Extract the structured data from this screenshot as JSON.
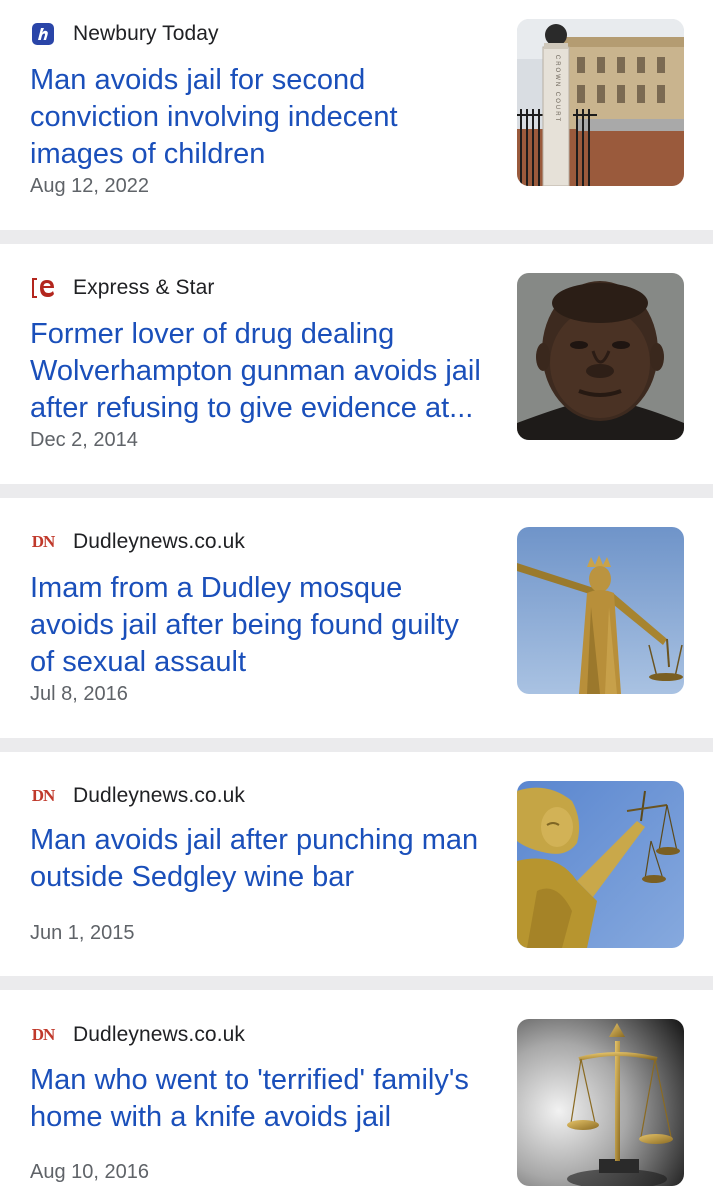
{
  "articles": [
    {
      "source": "Newbury Today",
      "logo": "newbury-today-logo",
      "headline": "Man avoids jail for second conviction involving indecent images of children",
      "date": "Aug 12, 2022",
      "image": "court-building-photo",
      "sign_text": "CROWN COURT"
    },
    {
      "source": "Express & Star",
      "logo": "express-and-star-logo",
      "headline": "Former lover of drug dealing Wolverhampton gunman avoids jail after refusing to give evidence at...",
      "date": "Dec 2, 2014",
      "image": "mugshot-photo"
    },
    {
      "source": "Dudleynews.co.uk",
      "logo": "dudley-news-logo",
      "logo_text": "DN",
      "headline": "Imam from a Dudley mosque avoids jail after being found guilty of sexual assault",
      "date": "Jul 8, 2016",
      "image": "lady-justice-statue-photo"
    },
    {
      "source": "Dudleynews.co.uk",
      "logo": "dudley-news-logo",
      "logo_text": "DN",
      "headline": "Man avoids jail after punching man outside Sedgley wine bar",
      "date": "Jun 1, 2015",
      "image": "justice-statue-scales-photo"
    },
    {
      "source": "Dudleynews.co.uk",
      "logo": "dudley-news-logo",
      "logo_text": "DN",
      "headline": "Man who went to 'terrified' family's home with a knife avoids jail",
      "date": "Aug 10, 2016",
      "image": "scales-of-justice-photo"
    }
  ],
  "colors": {
    "headline": "#1a4fba",
    "source": "#202124",
    "date": "#5f6368",
    "separator": "#ebebed",
    "express_star_red": "#b3261e",
    "dudley_red": "#c0392b",
    "newbury_blue": "#2a45a8"
  }
}
